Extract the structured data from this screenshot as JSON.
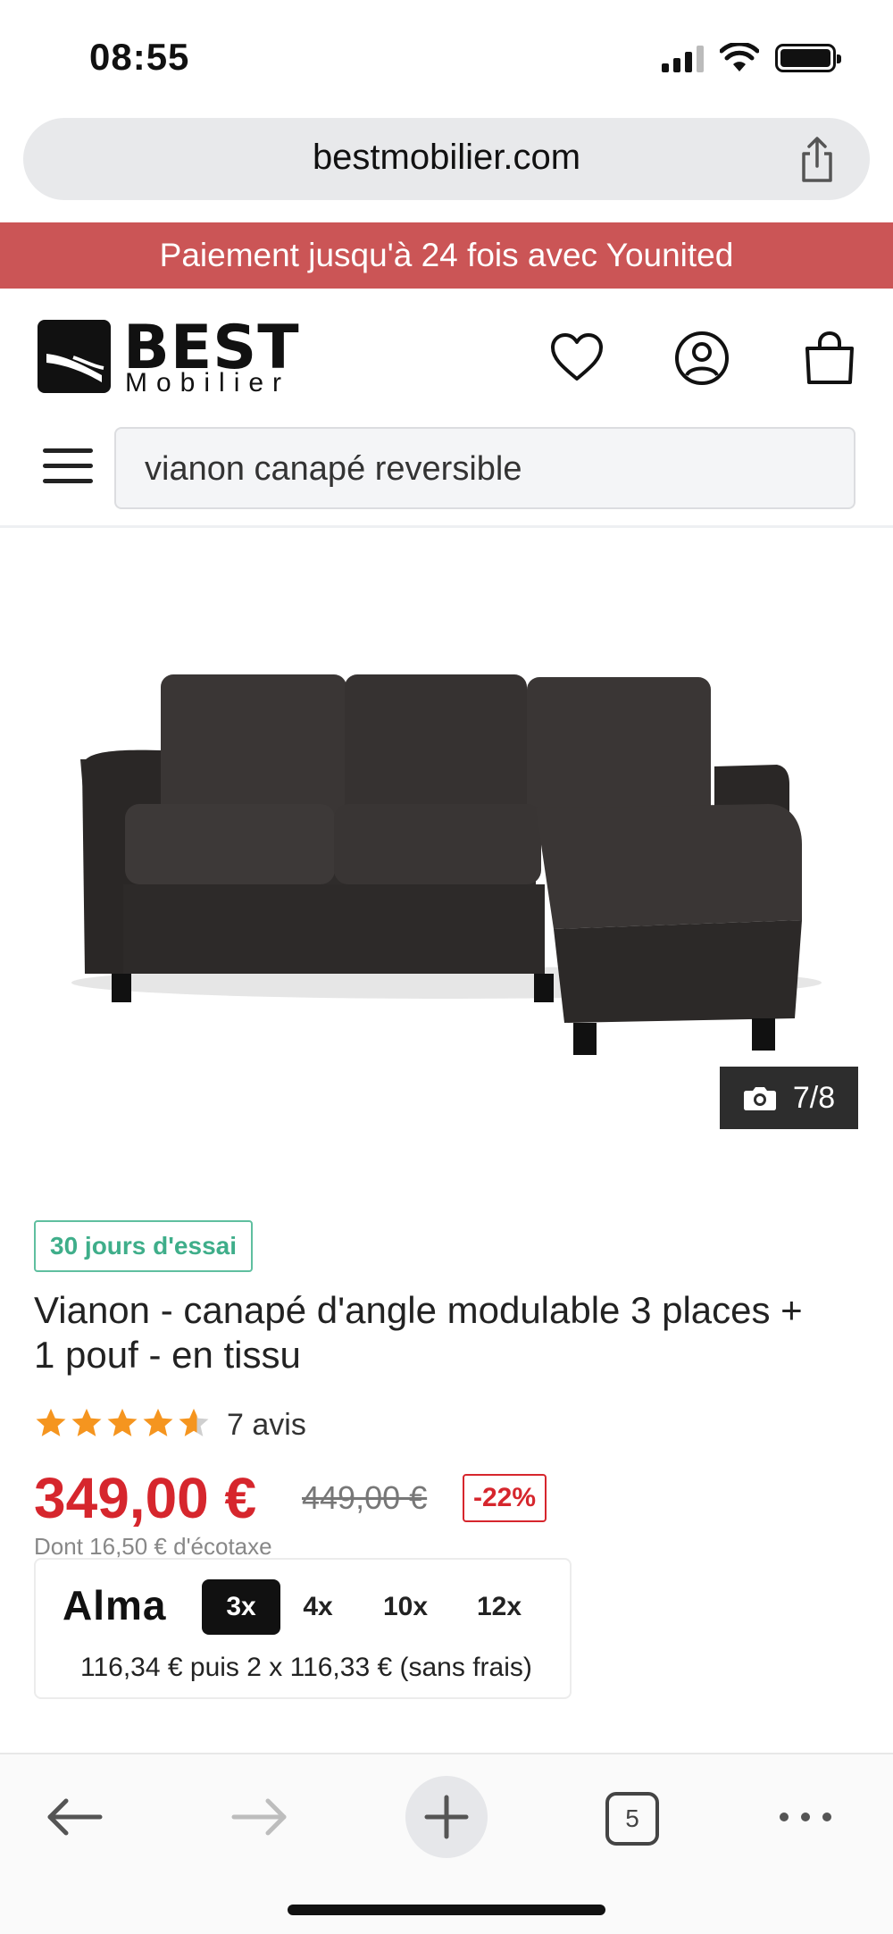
{
  "status_bar": {
    "time": "08:55"
  },
  "browser": {
    "url": "bestmobilier.com",
    "tab_count": "5"
  },
  "promo_banner": {
    "text": "Paiement jusqu'à 24 fois avec Younited"
  },
  "header": {
    "logo_primary": "BEST",
    "logo_secondary": "Mobilier"
  },
  "search": {
    "value": "vianon canapé reversible"
  },
  "gallery": {
    "counter": "7/8"
  },
  "product": {
    "trial_badge": "30 jours d'essai",
    "title": "Vianon - canapé d'angle modulable 3 places + 1 pouf - en tissu",
    "rating": 4.5,
    "reviews": "7 avis",
    "price": "349,00 €",
    "old_price": "449,00 €",
    "discount": "-22%",
    "ecotax": "Dont 16,50 € d'écotaxe"
  },
  "alma": {
    "logo": "Alma",
    "options": [
      "3x",
      "4x",
      "10x",
      "12x"
    ],
    "selected": "3x",
    "detail": "116,34 € puis 2 x 116,33 € (sans frais)"
  },
  "colors": {
    "promo_bg": "#cb5556",
    "price_red": "#d6262d",
    "trial_green": "#3fae8a",
    "star_orange": "#f5951f"
  }
}
